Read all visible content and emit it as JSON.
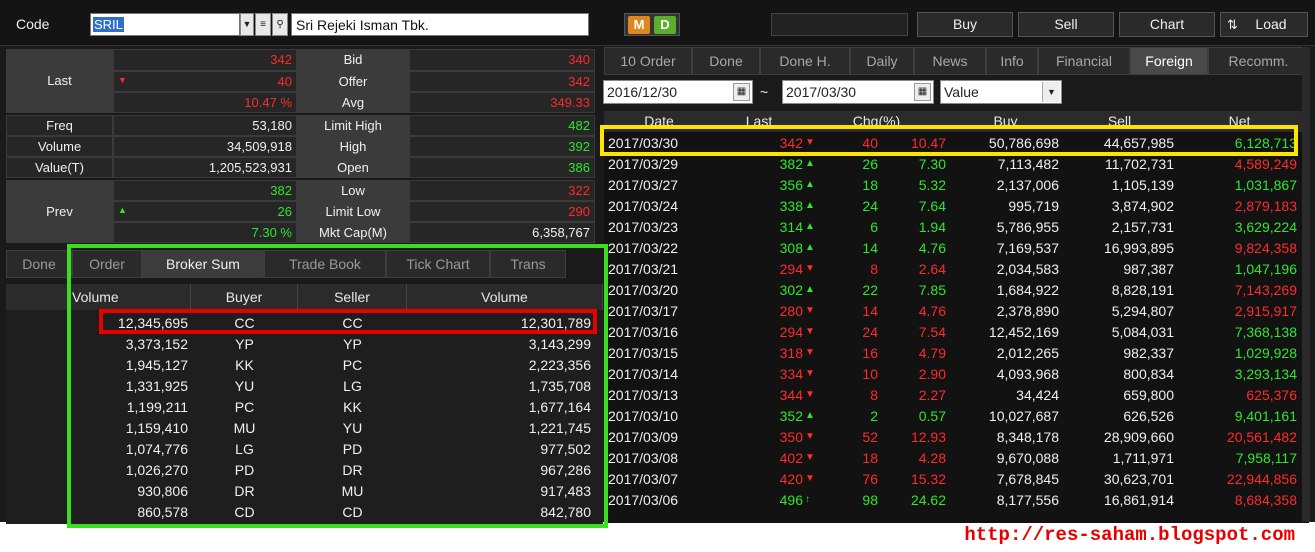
{
  "header": {
    "code_label": "Code",
    "code_value": "SRIL",
    "stock_name": "Sri Rejeki Isman Tbk.",
    "md_m": "M",
    "md_d": "D",
    "buttons": {
      "buy": "Buy",
      "sell": "Sell",
      "chart": "Chart",
      "load": "Load"
    }
  },
  "quote": {
    "last_label": "Last",
    "last": "342",
    "change": "40",
    "change_pct": "10.47 %",
    "bid_label": "Bid",
    "bid": "340",
    "offer_label": "Offer",
    "offer": "342",
    "avg_label": "Avg",
    "avg": "349.33",
    "freq_label": "Freq",
    "freq": "53,180",
    "volume_label": "Volume",
    "volume": "34,509,918",
    "value_label": "Value(T)",
    "value": "1,205,523,931",
    "limit_high_label": "Limit High",
    "limit_high": "482",
    "high_label": "High",
    "high": "392",
    "open_label": "Open",
    "open": "386",
    "prev_label": "Prev",
    "prev": "382",
    "prev_change": "26",
    "prev_change_pct": "7.30 %",
    "low_label": "Low",
    "low": "322",
    "limit_low_label": "Limit Low",
    "limit_low": "290",
    "mktcap_label": "Mkt Cap(M)",
    "mktcap": "6,358,767"
  },
  "broker_tabs": [
    "Done",
    "Order",
    "Broker Sum",
    "Trade Book",
    "Tick Chart",
    "Trans"
  ],
  "broker_table": {
    "headers": [
      "Volume",
      "Buyer",
      "Seller",
      "Volume"
    ],
    "rows": [
      [
        "12,345,695",
        "CC",
        "CC",
        "12,301,789"
      ],
      [
        "3,373,152",
        "YP",
        "YP",
        "3,143,299"
      ],
      [
        "1,945,127",
        "KK",
        "PC",
        "2,223,356"
      ],
      [
        "1,331,925",
        "YU",
        "LG",
        "1,735,708"
      ],
      [
        "1,199,211",
        "PC",
        "KK",
        "1,677,164"
      ],
      [
        "1,159,410",
        "MU",
        "YU",
        "1,221,745"
      ],
      [
        "1,074,776",
        "LG",
        "PD",
        "977,502"
      ],
      [
        "1,026,270",
        "PD",
        "DR",
        "967,286"
      ],
      [
        "930,806",
        "DR",
        "MU",
        "917,483"
      ],
      [
        "860,578",
        "CD",
        "CD",
        "842,780"
      ]
    ]
  },
  "right_tabs": [
    "10 Order",
    "Done",
    "Done H.",
    "Daily",
    "News",
    "Info",
    "Financial",
    "Foreign",
    "Recomm."
  ],
  "filter": {
    "date_from": "2016/12/30",
    "tilde": "~",
    "date_to": "2017/03/30",
    "mode": "Value"
  },
  "foreign_table": {
    "headers": [
      "Date",
      "Last",
      "Chg(%)",
      "Buy",
      "Sell",
      "Net"
    ],
    "rows": [
      {
        "date": "2017/03/30",
        "last": "342",
        "dir": "down",
        "chg": "40",
        "pct": "10.47",
        "buy": "50,786,698",
        "sell": "44,657,985",
        "net": "6,128,713",
        "net_dir": "up"
      },
      {
        "date": "2017/03/29",
        "last": "382",
        "dir": "up",
        "chg": "26",
        "pct": "7.30",
        "buy": "7,113,482",
        "sell": "11,702,731",
        "net": "4,589,249",
        "net_dir": "down"
      },
      {
        "date": "2017/03/27",
        "last": "356",
        "dir": "up",
        "chg": "18",
        "pct": "5.32",
        "buy": "2,137,006",
        "sell": "1,105,139",
        "net": "1,031,867",
        "net_dir": "up"
      },
      {
        "date": "2017/03/24",
        "last": "338",
        "dir": "up",
        "chg": "24",
        "pct": "7.64",
        "buy": "995,719",
        "sell": "3,874,902",
        "net": "2,879,183",
        "net_dir": "down"
      },
      {
        "date": "2017/03/23",
        "last": "314",
        "dir": "up",
        "chg": "6",
        "pct": "1.94",
        "buy": "5,786,955",
        "sell": "2,157,731",
        "net": "3,629,224",
        "net_dir": "up"
      },
      {
        "date": "2017/03/22",
        "last": "308",
        "dir": "up",
        "chg": "14",
        "pct": "4.76",
        "buy": "7,169,537",
        "sell": "16,993,895",
        "net": "9,824,358",
        "net_dir": "down"
      },
      {
        "date": "2017/03/21",
        "last": "294",
        "dir": "down",
        "chg": "8",
        "pct": "2.64",
        "buy": "2,034,583",
        "sell": "987,387",
        "net": "1,047,196",
        "net_dir": "up"
      },
      {
        "date": "2017/03/20",
        "last": "302",
        "dir": "up",
        "chg": "22",
        "pct": "7.85",
        "buy": "1,684,922",
        "sell": "8,828,191",
        "net": "7,143,269",
        "net_dir": "down"
      },
      {
        "date": "2017/03/17",
        "last": "280",
        "dir": "down",
        "chg": "14",
        "pct": "4.76",
        "buy": "2,378,890",
        "sell": "5,294,807",
        "net": "2,915,917",
        "net_dir": "down"
      },
      {
        "date": "2017/03/16",
        "last": "294",
        "dir": "down",
        "chg": "24",
        "pct": "7.54",
        "buy": "12,452,169",
        "sell": "5,084,031",
        "net": "7,368,138",
        "net_dir": "up"
      },
      {
        "date": "2017/03/15",
        "last": "318",
        "dir": "down",
        "chg": "16",
        "pct": "4.79",
        "buy": "2,012,265",
        "sell": "982,337",
        "net": "1,029,928",
        "net_dir": "up"
      },
      {
        "date": "2017/03/14",
        "last": "334",
        "dir": "down",
        "chg": "10",
        "pct": "2.90",
        "buy": "4,093,968",
        "sell": "800,834",
        "net": "3,293,134",
        "net_dir": "up"
      },
      {
        "date": "2017/03/13",
        "last": "344",
        "dir": "down",
        "chg": "8",
        "pct": "2.27",
        "buy": "34,424",
        "sell": "659,800",
        "net": "625,376",
        "net_dir": "down"
      },
      {
        "date": "2017/03/10",
        "last": "352",
        "dir": "up",
        "chg": "2",
        "pct": "0.57",
        "buy": "10,027,687",
        "sell": "626,526",
        "net": "9,401,161",
        "net_dir": "up"
      },
      {
        "date": "2017/03/09",
        "last": "350",
        "dir": "down",
        "chg": "52",
        "pct": "12.93",
        "buy": "8,348,178",
        "sell": "28,909,660",
        "net": "20,561,482",
        "net_dir": "down"
      },
      {
        "date": "2017/03/08",
        "last": "402",
        "dir": "down",
        "chg": "18",
        "pct": "4.28",
        "buy": "9,670,088",
        "sell": "1,711,971",
        "net": "7,958,117",
        "net_dir": "up"
      },
      {
        "date": "2017/03/07",
        "last": "420",
        "dir": "down",
        "chg": "76",
        "pct": "15.32",
        "buy": "7,678,845",
        "sell": "30,623,701",
        "net": "22,944,856",
        "net_dir": "down"
      },
      {
        "date": "2017/03/06",
        "last": "496",
        "dir": "limit-up",
        "chg": "98",
        "pct": "24.62",
        "buy": "8,177,556",
        "sell": "16,861,914",
        "net": "8,684,358",
        "net_dir": "down"
      }
    ]
  },
  "footer_url": "http://res-saham.blogspot.com",
  "colors": {
    "up": "#2ee62e",
    "down": "#ff2a2a",
    "highlight_yellow": "#ffe400",
    "highlight_green": "#3cdc1e",
    "highlight_red": "#e60000"
  }
}
